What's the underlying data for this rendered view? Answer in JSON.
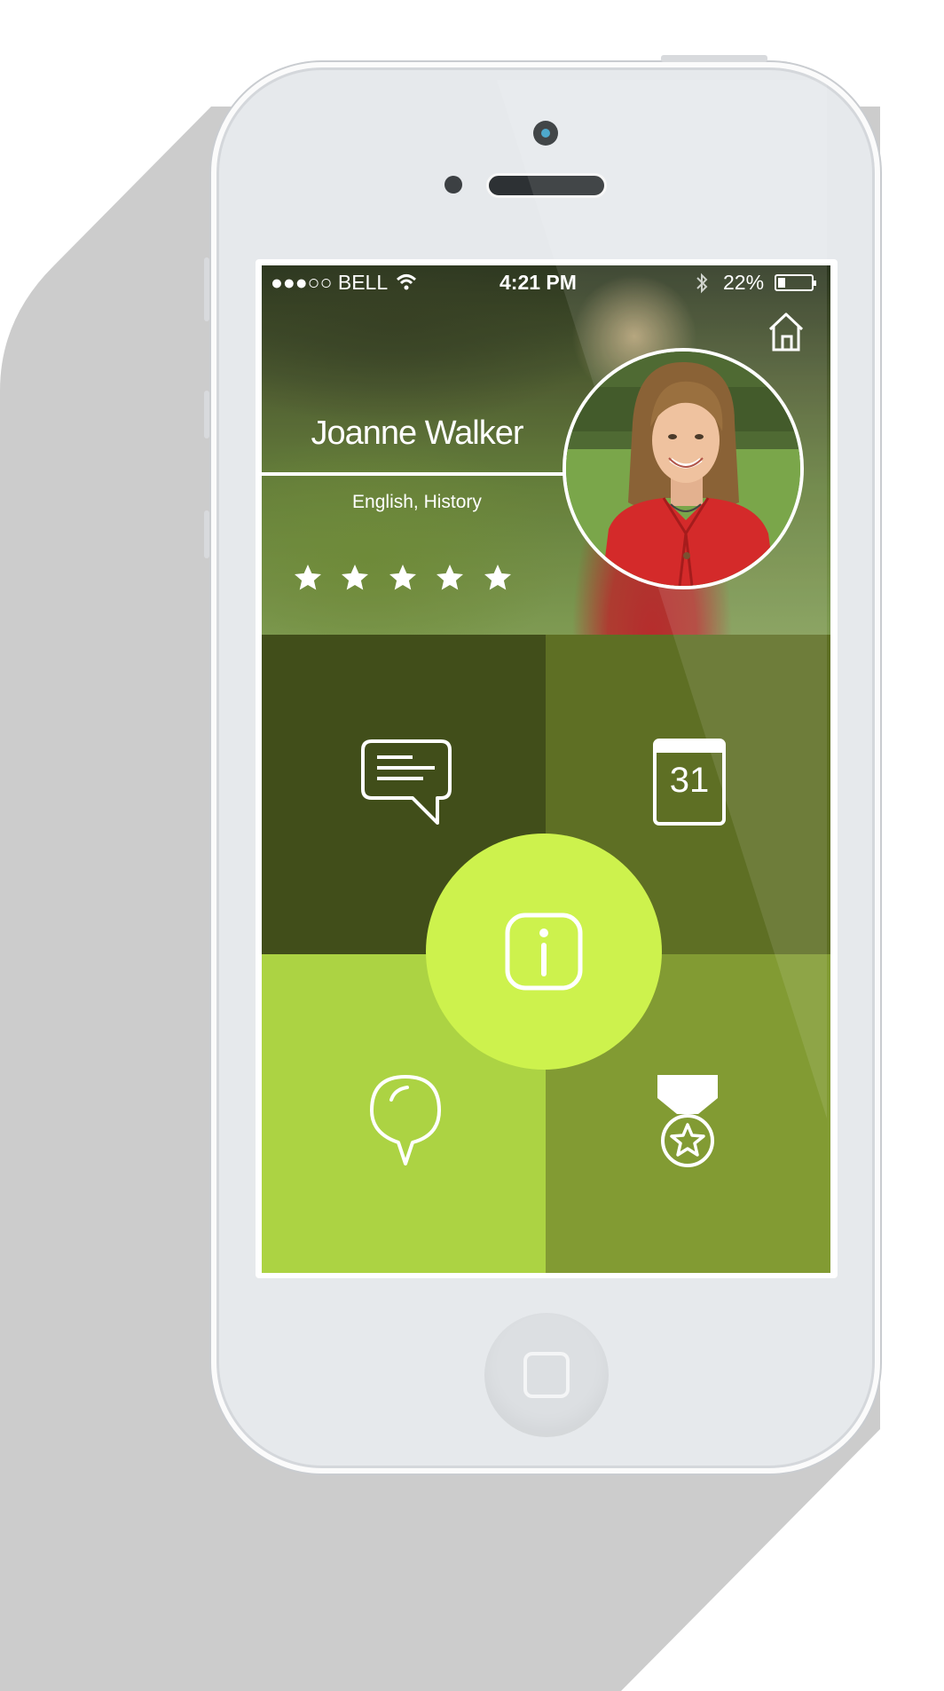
{
  "status_bar": {
    "carrier": "●●●○○ BELL",
    "time": "4:21 PM",
    "battery": "22%",
    "battery_level": 0.22
  },
  "profile": {
    "name": "Joanne Walker",
    "subjects": "English, History",
    "rating": 5
  },
  "tiles": {
    "messages": "chat-bubble-icon",
    "calendar": "calendar-icon",
    "calendar_day": "31",
    "location": "location-pin-icon",
    "awards": "medal-icon",
    "info": "info-icon"
  },
  "colors": {
    "tile_messages": "#414e1a",
    "tile_calendar": "#5e6f24",
    "tile_location": "#acd343",
    "tile_awards": "#829b33",
    "info_button": "#cdf24d"
  }
}
